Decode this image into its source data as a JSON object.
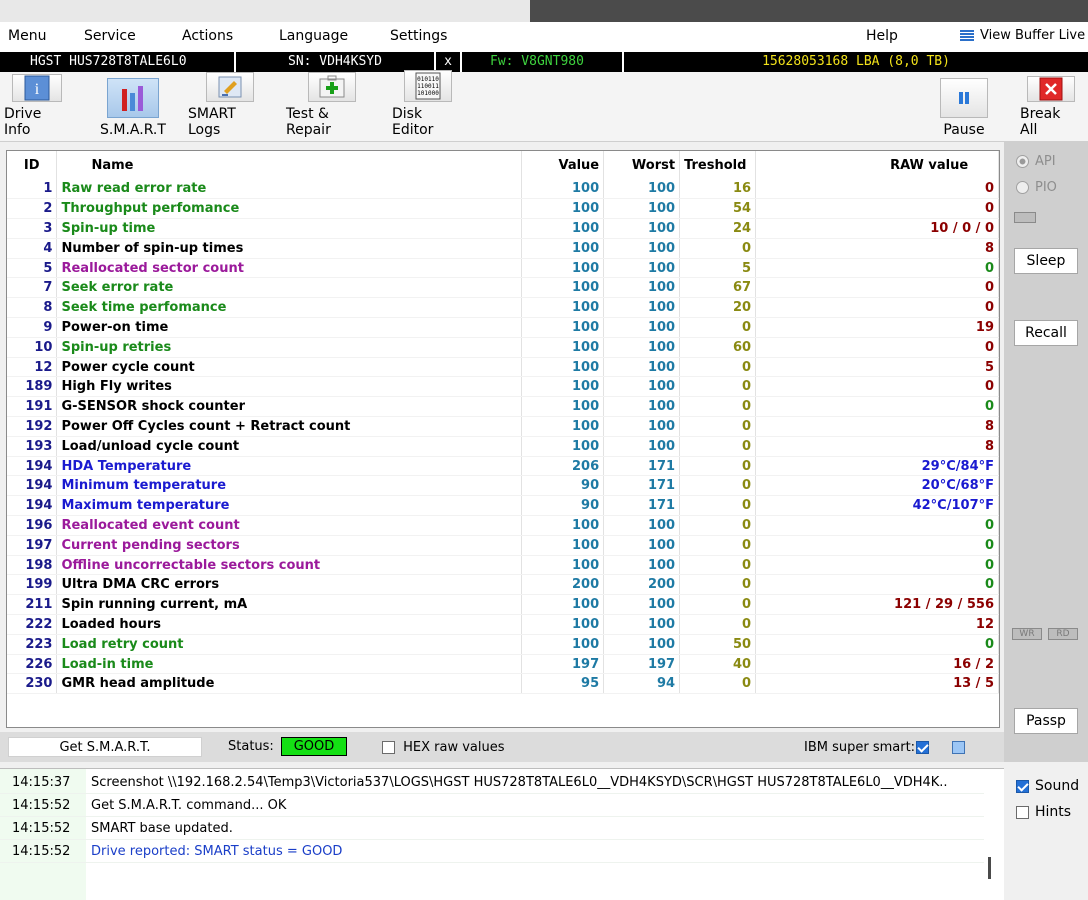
{
  "menu": {
    "items": [
      "Menu",
      "Service",
      "Actions",
      "Language",
      "Settings"
    ],
    "help": "Help",
    "view_buffer": "View Buffer Live"
  },
  "drive": {
    "model": "HGST HUS728T8TALE6L0",
    "sn": "SN: VDH4KSYD",
    "close": "x",
    "fw": "Fw: V8GNT980",
    "lba": "15628053168 LBA (8,0 TB)"
  },
  "toolbar": {
    "drive_info": "Drive Info",
    "smart": "S.M.A.R.T",
    "smart_logs": "SMART Logs",
    "test_repair": "Test & Repair",
    "disk_editor": "Disk Editor",
    "pause": "Pause",
    "break_all": "Break All"
  },
  "grid": {
    "headers": {
      "id": "ID",
      "name": "Name",
      "value": "Value",
      "worst": "Worst",
      "threshold": "Treshold",
      "raw": "RAW value"
    },
    "colors": {
      "green": "#1a8a1a",
      "black": "#000000",
      "purple": "#9b1a9b",
      "blue": "#1a1ad0",
      "raw_red": "#8b0000",
      "raw_green": "#1a8a1a",
      "raw_blue": "#1a1ad0"
    },
    "rows": [
      {
        "id": "1",
        "name": "Raw read error rate",
        "value": "100",
        "worst": "100",
        "thr": "16",
        "raw": "0",
        "nc": "green",
        "rc": "raw_red"
      },
      {
        "id": "2",
        "name": "Throughput perfomance",
        "value": "100",
        "worst": "100",
        "thr": "54",
        "raw": "0",
        "nc": "green",
        "rc": "raw_red"
      },
      {
        "id": "3",
        "name": "Spin-up time",
        "value": "100",
        "worst": "100",
        "thr": "24",
        "raw": "10 / 0 / 0",
        "nc": "green",
        "rc": "raw_red"
      },
      {
        "id": "4",
        "name": "Number of spin-up times",
        "value": "100",
        "worst": "100",
        "thr": "0",
        "raw": "8",
        "nc": "black",
        "rc": "raw_red"
      },
      {
        "id": "5",
        "name": "Reallocated sector count",
        "value": "100",
        "worst": "100",
        "thr": "5",
        "raw": "0",
        "nc": "purple",
        "rc": "raw_green"
      },
      {
        "id": "7",
        "name": "Seek error rate",
        "value": "100",
        "worst": "100",
        "thr": "67",
        "raw": "0",
        "nc": "green",
        "rc": "raw_red"
      },
      {
        "id": "8",
        "name": "Seek time perfomance",
        "value": "100",
        "worst": "100",
        "thr": "20",
        "raw": "0",
        "nc": "green",
        "rc": "raw_red"
      },
      {
        "id": "9",
        "name": "Power-on time",
        "value": "100",
        "worst": "100",
        "thr": "0",
        "raw": "19",
        "nc": "black",
        "rc": "raw_red"
      },
      {
        "id": "10",
        "name": "Spin-up retries",
        "value": "100",
        "worst": "100",
        "thr": "60",
        "raw": "0",
        "nc": "green",
        "rc": "raw_red"
      },
      {
        "id": "12",
        "name": "Power cycle count",
        "value": "100",
        "worst": "100",
        "thr": "0",
        "raw": "5",
        "nc": "black",
        "rc": "raw_red"
      },
      {
        "id": "189",
        "name": "High Fly writes",
        "value": "100",
        "worst": "100",
        "thr": "0",
        "raw": "0",
        "nc": "black",
        "rc": "raw_red"
      },
      {
        "id": "191",
        "name": "G-SENSOR shock counter",
        "value": "100",
        "worst": "100",
        "thr": "0",
        "raw": "0",
        "nc": "black",
        "rc": "raw_green"
      },
      {
        "id": "192",
        "name": "Power Off Cycles count + Retract count",
        "value": "100",
        "worst": "100",
        "thr": "0",
        "raw": "8",
        "nc": "black",
        "rc": "raw_red"
      },
      {
        "id": "193",
        "name": "Load/unload cycle count",
        "value": "100",
        "worst": "100",
        "thr": "0",
        "raw": "8",
        "nc": "black",
        "rc": "raw_red"
      },
      {
        "id": "194",
        "name": "HDA Temperature",
        "value": "206",
        "worst": "171",
        "thr": "0",
        "raw": "29°C/84°F",
        "nc": "blue",
        "rc": "raw_blue"
      },
      {
        "id": "194",
        "name": "Minimum temperature",
        "value": "90",
        "worst": "171",
        "thr": "0",
        "raw": "20°C/68°F",
        "nc": "blue",
        "rc": "raw_blue"
      },
      {
        "id": "194",
        "name": "Maximum temperature",
        "value": "90",
        "worst": "171",
        "thr": "0",
        "raw": "42°C/107°F",
        "nc": "blue",
        "rc": "raw_blue"
      },
      {
        "id": "196",
        "name": "Reallocated event count",
        "value": "100",
        "worst": "100",
        "thr": "0",
        "raw": "0",
        "nc": "purple",
        "rc": "raw_green"
      },
      {
        "id": "197",
        "name": "Current pending sectors",
        "value": "100",
        "worst": "100",
        "thr": "0",
        "raw": "0",
        "nc": "purple",
        "rc": "raw_green"
      },
      {
        "id": "198",
        "name": "Offline uncorrectable sectors count",
        "value": "100",
        "worst": "100",
        "thr": "0",
        "raw": "0",
        "nc": "purple",
        "rc": "raw_green"
      },
      {
        "id": "199",
        "name": "Ultra DMA CRC errors",
        "value": "200",
        "worst": "200",
        "thr": "0",
        "raw": "0",
        "nc": "black",
        "rc": "raw_green"
      },
      {
        "id": "211",
        "name": "Spin running current, mA",
        "value": "100",
        "worst": "100",
        "thr": "0",
        "raw": "121 / 29 / 556",
        "nc": "black",
        "rc": "raw_red"
      },
      {
        "id": "222",
        "name": "Loaded hours",
        "value": "100",
        "worst": "100",
        "thr": "0",
        "raw": "12",
        "nc": "black",
        "rc": "raw_red"
      },
      {
        "id": "223",
        "name": "Load retry count",
        "value": "100",
        "worst": "100",
        "thr": "50",
        "raw": "0",
        "nc": "green",
        "rc": "raw_green"
      },
      {
        "id": "226",
        "name": "Load-in time",
        "value": "197",
        "worst": "197",
        "thr": "40",
        "raw": "16 / 2",
        "nc": "green",
        "rc": "raw_red"
      },
      {
        "id": "230",
        "name": "GMR head amplitude",
        "value": "95",
        "worst": "94",
        "thr": "0",
        "raw": "13 / 5",
        "nc": "black",
        "rc": "raw_red"
      }
    ]
  },
  "side": {
    "api": "API",
    "pio": "PIO",
    "sleep": "Sleep",
    "recall": "Recall",
    "wr": "WR",
    "rd": "RD",
    "passp": "Passp"
  },
  "status": {
    "get_smart": "Get S.M.A.R.T.",
    "status_label": "Status:",
    "status_value": "GOOD",
    "status_color": "#14e014",
    "hex_label": "HEX raw values",
    "ibm_label": "IBM super smart:"
  },
  "log": [
    {
      "time": "14:15:37",
      "msg": "Screenshot \\\\192.168.2.54\\Temp3\\Victoria537\\LOGS\\HGST HUS728T8TALE6L0__VDH4KSYD\\SCR\\HGST HUS728T8TALE6L0__VDH4K..",
      "color": "#000000"
    },
    {
      "time": "14:15:52",
      "msg": "Get S.M.A.R.T. command... OK",
      "color": "#000000"
    },
    {
      "time": "14:15:52",
      "msg": "SMART base updated.",
      "color": "#000000"
    },
    {
      "time": "14:15:52",
      "msg": "Drive reported: SMART status = GOOD",
      "color": "#1a3ec8"
    }
  ],
  "options": {
    "sound": "Sound",
    "hints": "Hints"
  }
}
